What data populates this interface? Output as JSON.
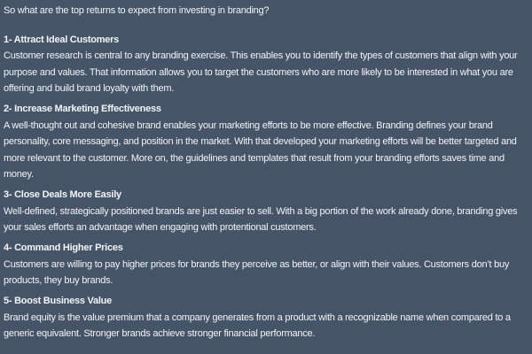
{
  "intro": "So what are the top returns to expect from investing in branding?",
  "sections": [
    {
      "heading": "1- Attract Ideal Customers",
      "lines": [
        "Customer research is central to any branding exercise. This enables you to identify the types of customers that align with your",
        "purpose and values. That information allows you to target the customers who are more likely to be interested in what you are",
        "offering and build brand loyalty with them."
      ]
    },
    {
      "heading": "2- Increase Marketing Effectiveness",
      "lines": [
        "A well-thought out and cohesive brand enables your marketing efforts to be more effective. Branding defines your brand",
        "personality, core messaging, and position in the market. With that developed your marketing efforts will be better targeted and",
        "more relevant to the customer. More on, the guidelines and templates that result from your branding efforts saves time and",
        "money."
      ]
    },
    {
      "heading": "3- Close Deals More Easily",
      "lines": [
        "Well-defined, strategically positioned brands are just easier to sell. With a big portion of the work already done, branding gives",
        "your sales efforts an advantage when engaging with protentional customers."
      ]
    },
    {
      "heading": "4- Command Higher Prices",
      "lines": [
        "Customers are willing to pay higher prices for brands they perceive as better, or align with their values. Customers don’t buy",
        "products, they buy brands."
      ]
    },
    {
      "heading": "5- Boost Business Value",
      "lines": [
        "Brand equity is the value premium that a company generates from a product with a recognizable name when compared to a",
        "generic equivalent. Stronger brands achieve stronger financial performance."
      ]
    }
  ]
}
